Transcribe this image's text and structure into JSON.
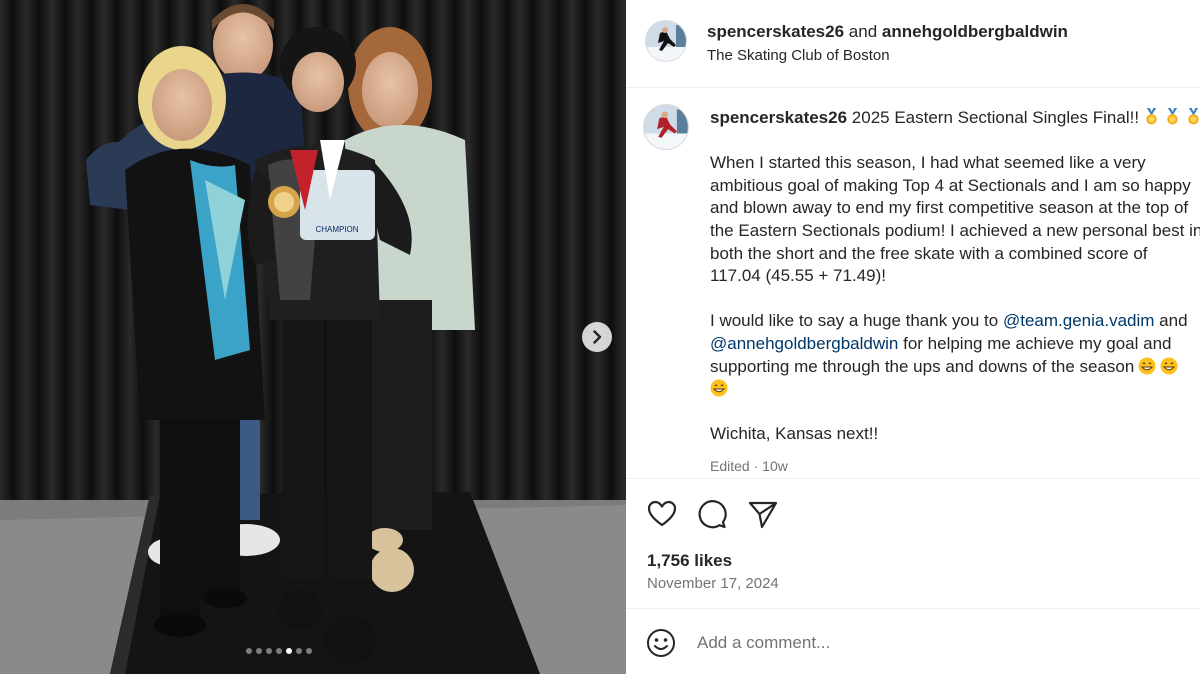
{
  "carousel": {
    "next_icon": "chevron-right-icon",
    "dots_total": 7,
    "active_dot": 4,
    "medal_text": "CHAMPION"
  },
  "header": {
    "username": "spencerskates26",
    "and_text": "and",
    "collaborator": "annehgoldbergbaldwin",
    "location": "The Skating Club of Boston"
  },
  "caption": {
    "username": "spencerskates26",
    "title": "2025 Eastern Sectional Singles Final!!",
    "lines_para1": [
      "When I started this season, I had what seemed like a very",
      "ambitious goal of making Top 4 at Sectionals and I am so happy",
      "and blown away to end my first competitive season at the top of",
      "the Eastern Sectionals podium! I achieved a new personal best in",
      "both the short and the free skate with a combined score of",
      "117.04 (45.55 + 71.49)!"
    ],
    "para2_prefix": "I would like to say a huge thank you to",
    "mention1": "@team.genia.vadim",
    "para2_and": "and",
    "mention2": "@annehgoldbergbaldwin",
    "para2_rest": "for helping me achieve my goal and",
    "para2_line3": "supporting me through the ups and downs of the season",
    "para3": "Wichita, Kansas next!!",
    "edited": "Edited",
    "edited_sep": " · ",
    "edited_age": "10w"
  },
  "actions": {
    "like_icon": "heart-icon",
    "comment_icon": "comment-icon",
    "share_icon": "send-icon",
    "likes": "1,756 likes",
    "date": "November 17, 2024"
  },
  "comment": {
    "emoji_icon": "smiley-icon",
    "placeholder": "Add a comment..."
  },
  "colors": {
    "text": "#262626",
    "secondary": "#737373",
    "mention": "#00376b",
    "divider": "#efefef"
  }
}
